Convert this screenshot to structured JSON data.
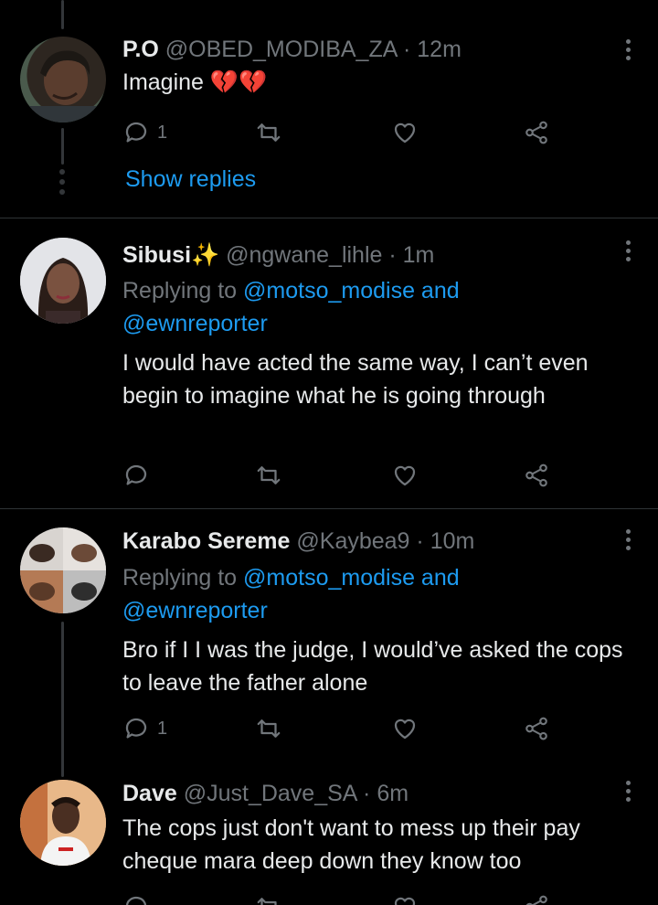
{
  "tweets": [
    {
      "name": "P.O",
      "handle": "@OBED_MODIBA_ZA",
      "time": "· 12m",
      "text": "Imagine 💔💔",
      "reply_count": "1",
      "show_replies": "Show replies"
    },
    {
      "name": "Sibusi✨",
      "handle": "@ngwane_lihle",
      "time": "· 1m",
      "replying_prefix": "Replying to",
      "replying_mention1": "@motso_modise and",
      "replying_mention2": "@ewnreporter",
      "text": "I would have acted the same way, I can’t even begin to imagine what he is going through",
      "reply_count": ""
    },
    {
      "name": "Karabo Sereme",
      "handle": "@Kaybea9",
      "time": "· 10m",
      "replying_prefix": "Replying to",
      "replying_mention1": "@motso_modise and",
      "replying_mention2": "@ewnreporter",
      "text": "Bro if I I was the judge, I would’ve asked the cops to leave the father alone",
      "reply_count": "1"
    },
    {
      "name": "Dave",
      "handle": "@Just_Dave_SA",
      "time": "· 6m",
      "text": "The cops just don't want to mess up their pay cheque mara deep down they know too",
      "reply_count": ""
    }
  ],
  "colors": {
    "background": "#000000",
    "text": "#e7e9ea",
    "secondary": "#71767b",
    "accent": "#1d9bf0",
    "divider": "#2f3336"
  }
}
